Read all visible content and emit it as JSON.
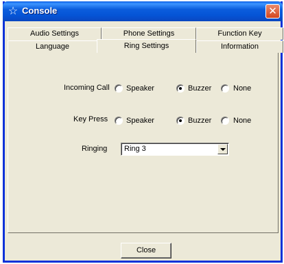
{
  "window": {
    "title": "Console",
    "title_icon": "star-icon",
    "close_icon": "close-icon"
  },
  "tabs": {
    "row1": [
      "Audio Settings",
      "Phone Settings",
      "Function Key"
    ],
    "row2": [
      "Language",
      "Ring Settings",
      "Information"
    ],
    "active": "Ring Settings"
  },
  "ring_settings": {
    "incoming_call": {
      "label": "Incoming Call",
      "options": [
        "Speaker",
        "Buzzer",
        "None"
      ],
      "selected": "Buzzer"
    },
    "key_press": {
      "label": "Key Press",
      "options": [
        "Speaker",
        "Buzzer",
        "None"
      ],
      "selected": "Buzzer"
    },
    "ringing": {
      "label": "Ringing",
      "value": "Ring 3"
    }
  },
  "footer": {
    "close_label": "Close"
  },
  "colors": {
    "titlebar": "#0b5ddd",
    "window_bg": "#ece9d8",
    "close_button": "#d3461f"
  }
}
